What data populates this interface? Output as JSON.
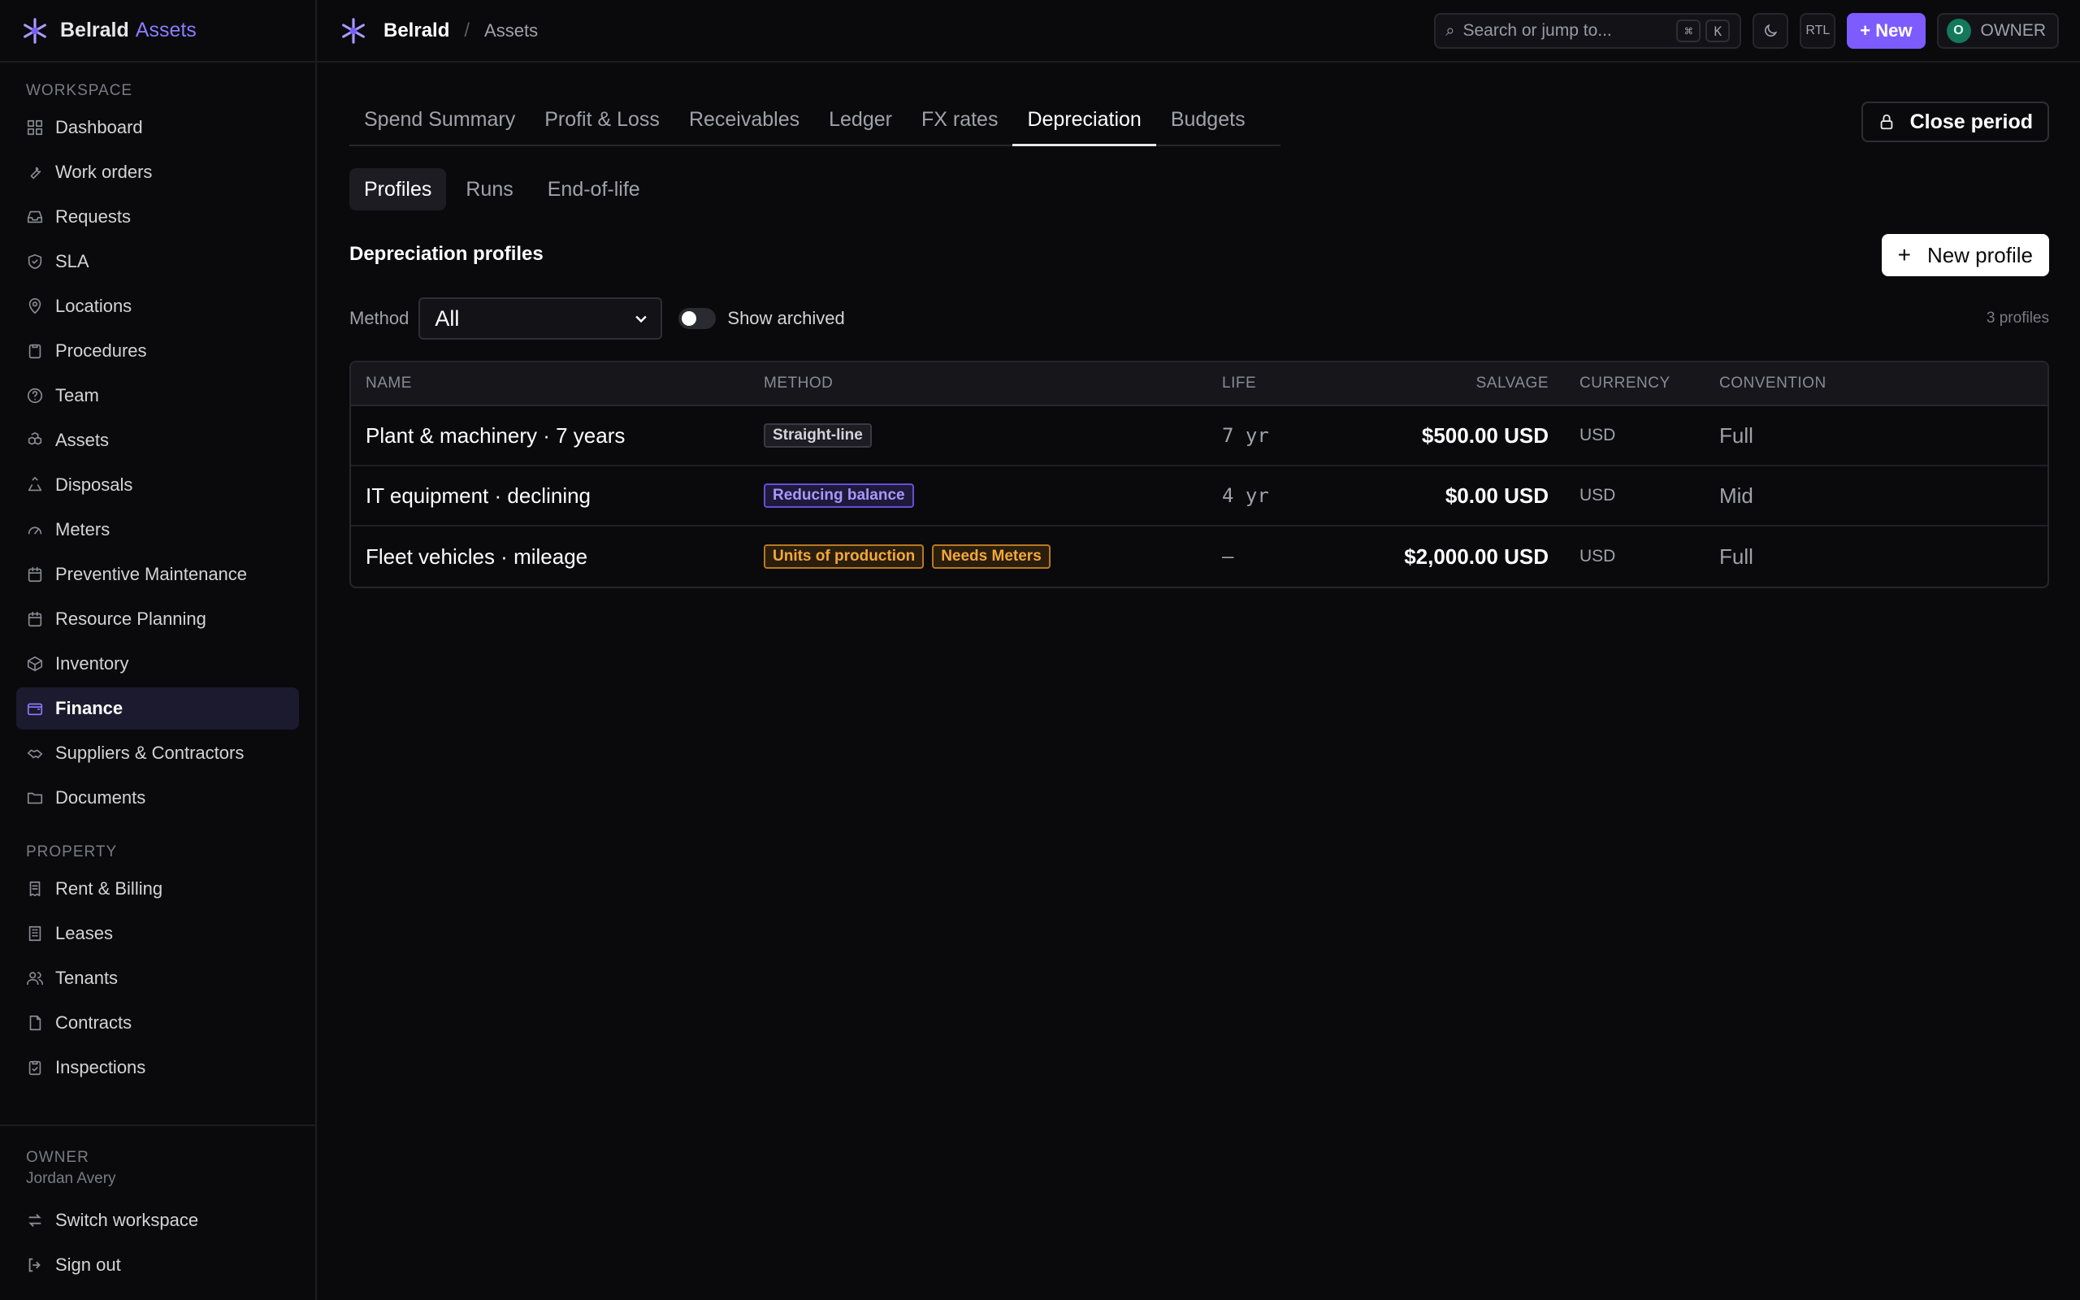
{
  "brand": {
    "name": "Belrald",
    "product": "Assets"
  },
  "breadcrumb": {
    "org": "Belrald",
    "separator": "/",
    "page": "Assets"
  },
  "topbar": {
    "search_placeholder": "Search or jump to...",
    "shortcut_mod": "⌘",
    "shortcut_key": "K",
    "rtl_label": "RTL",
    "new_label": "+ New",
    "avatar_initial": "O",
    "role_label": "OWNER"
  },
  "sidebar": {
    "workspace_label": "WORKSPACE",
    "workspace_items": [
      {
        "label": "Dashboard",
        "icon": "grid-icon"
      },
      {
        "label": "Work orders",
        "icon": "wrench-icon"
      },
      {
        "label": "Requests",
        "icon": "inbox-icon"
      },
      {
        "label": "SLA",
        "icon": "shield-icon"
      },
      {
        "label": "Locations",
        "icon": "pin-icon"
      },
      {
        "label": "Procedures",
        "icon": "clipboard-icon"
      },
      {
        "label": "Team",
        "icon": "help-circle-icon"
      },
      {
        "label": "Assets",
        "icon": "boxes-icon"
      },
      {
        "label": "Disposals",
        "icon": "recycle-icon"
      },
      {
        "label": "Meters",
        "icon": "gauge-icon"
      },
      {
        "label": "Preventive Maintenance",
        "icon": "calendar-icon"
      },
      {
        "label": "Resource Planning",
        "icon": "calendar-icon"
      },
      {
        "label": "Inventory",
        "icon": "box-icon"
      },
      {
        "label": "Finance",
        "icon": "wallet-icon",
        "active": true
      },
      {
        "label": "Suppliers & Contractors",
        "icon": "handshake-icon"
      },
      {
        "label": "Documents",
        "icon": "folder-icon"
      }
    ],
    "property_label": "PROPERTY",
    "property_items": [
      {
        "label": "Rent & Billing",
        "icon": "receipt-icon"
      },
      {
        "label": "Leases",
        "icon": "building-icon"
      },
      {
        "label": "Tenants",
        "icon": "users-icon"
      },
      {
        "label": "Contracts",
        "icon": "file-icon"
      },
      {
        "label": "Inspections",
        "icon": "clipboard-check-icon"
      }
    ],
    "footer": {
      "role": "OWNER",
      "user": "Jordan Avery",
      "switch_label": "Switch workspace",
      "signout_label": "Sign out"
    }
  },
  "tabs": [
    "Spend Summary",
    "Profit & Loss",
    "Receivables",
    "Ledger",
    "FX rates",
    "Depreciation",
    "Budgets"
  ],
  "active_tab": "Depreciation",
  "close_period_label": "Close period",
  "subtabs": [
    "Profiles",
    "Runs",
    "End-of-life"
  ],
  "active_subtab": "Profiles",
  "section_title": "Depreciation profiles",
  "new_profile_label": "New profile",
  "filters": {
    "method_label": "Method",
    "method_value": "All",
    "show_archived_label": "Show archived",
    "count_label": "3 profiles"
  },
  "table": {
    "columns": [
      "NAME",
      "METHOD",
      "LIFE",
      "SALVAGE",
      "CURRENCY",
      "CONVENTION"
    ],
    "rows": [
      {
        "name": "Plant & machinery · 7 years",
        "badges": [
          {
            "text": "Straight-line",
            "tone": "gray"
          }
        ],
        "life": "7 yr",
        "salvage": "$500.00 USD",
        "currency": "USD",
        "convention": "Full"
      },
      {
        "name": "IT equipment · declining",
        "badges": [
          {
            "text": "Reducing balance",
            "tone": "purple"
          }
        ],
        "life": "4 yr",
        "salvage": "$0.00 USD",
        "currency": "USD",
        "convention": "Mid"
      },
      {
        "name": "Fleet vehicles · mileage",
        "badges": [
          {
            "text": "Units of production",
            "tone": "amber"
          },
          {
            "text": "Needs Meters",
            "tone": "amber"
          }
        ],
        "life": "—",
        "salvage": "$2,000.00 USD",
        "currency": "USD",
        "convention": "Full"
      }
    ]
  },
  "colors": {
    "accent": "#7c5cff",
    "accent_text": "#8b7bff",
    "background": "#0a0a0d"
  }
}
